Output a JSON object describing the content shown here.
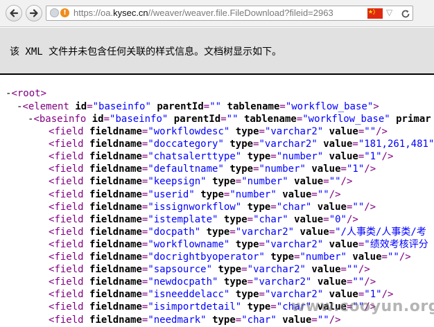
{
  "browser": {
    "url_prefix": "https://oa.",
    "url_host": "kysec.cn",
    "url_path": "//weaver/weaver.file.FileDownload?fileid=2963",
    "back_icon": "back-arrow-icon",
    "forward_icon": "forward-arrow-icon",
    "flag_color": "#de2910"
  },
  "banner": {
    "message": "该 XML 文件并未包含任何关联的样式信息。文档树显示如下。"
  },
  "xml": {
    "root": {
      "toggle": "-",
      "open": "<",
      "name": "root",
      "close": ">"
    },
    "element": {
      "toggle": "-",
      "open": "<",
      "name": "element",
      "attrs": [
        {
          "name": "id",
          "value": "\"baseinfo\""
        },
        {
          "name": "parentId",
          "value": "\"\""
        },
        {
          "name": "tablename",
          "value": "\"workflow_base\""
        }
      ],
      "close": ">"
    },
    "baseinfo": {
      "toggle": "-",
      "open": "<",
      "name": "baseinfo",
      "attrs": [
        {
          "name": "id",
          "value": "\"baseinfo\""
        },
        {
          "name": "parentId",
          "value": "\"\""
        },
        {
          "name": "tablename",
          "value": "\"workflow_base\""
        },
        {
          "name": "primar",
          "value": ""
        }
      ]
    },
    "fields": [
      {
        "fieldname": "\"workflowdesc\"",
        "type": "\"varchar2\"",
        "value": "\"\"",
        "end": "/>"
      },
      {
        "fieldname": "\"doccategory\"",
        "type": "\"varchar2\"",
        "value": "\"181,261,481\"",
        "end": "/"
      },
      {
        "fieldname": "\"chatsalerttype\"",
        "type": "\"number\"",
        "value": "\"1\"",
        "end": "/>"
      },
      {
        "fieldname": "\"defaultname\"",
        "type": "\"number\"",
        "value": "\"1\"",
        "end": "/>"
      },
      {
        "fieldname": "\"keepsign\"",
        "type": "\"number\"",
        "value": "\"\"",
        "end": "/>"
      },
      {
        "fieldname": "\"userid\"",
        "type": "\"number\"",
        "value": "\"\"",
        "end": "/>"
      },
      {
        "fieldname": "\"issignworkflow\"",
        "type": "\"char\"",
        "value": "\"\"",
        "end": "/>"
      },
      {
        "fieldname": "\"istemplate\"",
        "type": "\"char\"",
        "value": "\"0\"",
        "end": "/>"
      },
      {
        "fieldname": "\"docpath\"",
        "type": "\"varchar2\"",
        "value": "\"/人事类/人事类/考",
        "end": ""
      },
      {
        "fieldname": "\"workflowname\"",
        "type": "\"varchar2\"",
        "value": "\"绩效考核评分",
        "end": ""
      },
      {
        "fieldname": "\"docrightbyoperator\"",
        "type": "\"number\"",
        "value": "\"\"",
        "end": "/>"
      },
      {
        "fieldname": "\"sapsource\"",
        "type": "\"varchar2\"",
        "value": "\"\"",
        "end": "/>"
      },
      {
        "fieldname": "\"newdocpath\"",
        "type": "\"varchar2\"",
        "value": "\"\"",
        "end": "/>"
      },
      {
        "fieldname": "\"isneeddelacc\"",
        "type": "\"varchar2\"",
        "value": "\"1\"",
        "end": "/>"
      },
      {
        "fieldname": "\"isimportdetail\"",
        "type": "\"char\"",
        "value": "\"\"",
        "end": "/>"
      },
      {
        "fieldname": "\"needmark\"",
        "type": "\"char\"",
        "value": "\"\"",
        "end": "/>"
      }
    ],
    "field_tag": "field",
    "attr_fieldname": "fieldname",
    "attr_type": "type",
    "attr_value": "value"
  },
  "watermark": "www.cooyun.org"
}
